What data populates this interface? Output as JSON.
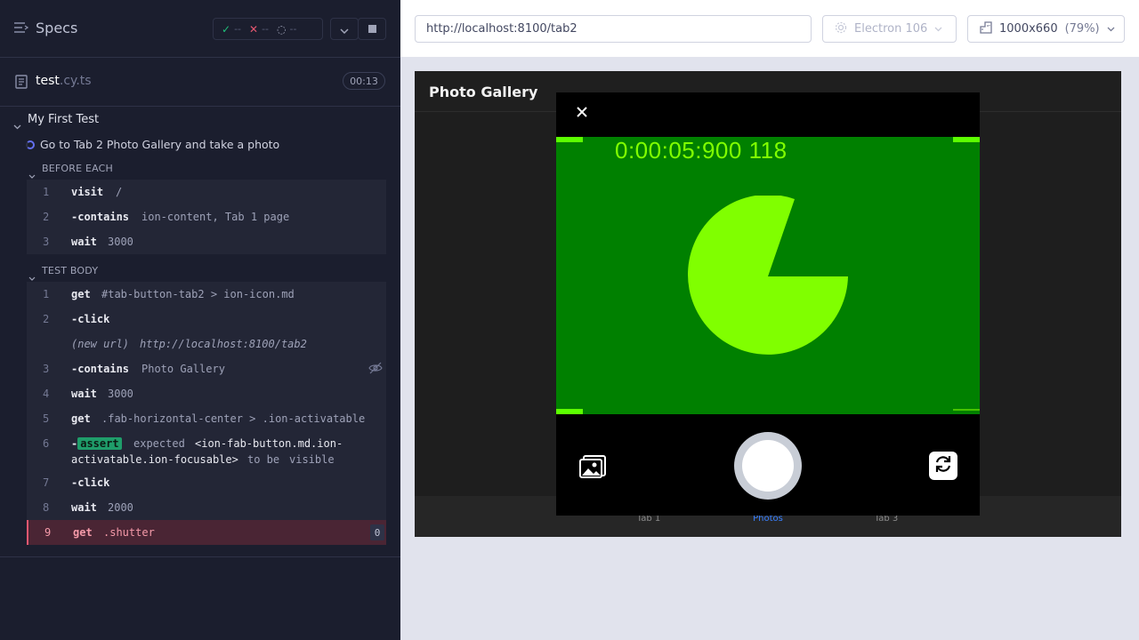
{
  "reporter": {
    "specs_label": "Specs",
    "stats": {
      "passed": "--",
      "failed": "--",
      "pending": "--"
    },
    "spec_file": {
      "name": "test",
      "ext": ".cy.ts",
      "duration": "00:13"
    },
    "suite_title": "My First Test",
    "test_title": "Go to Tab 2 Photo Gallery and take a photo",
    "before_each_label": "BEFORE EACH",
    "test_body_label": "TEST BODY",
    "before_each": [
      {
        "num": "1",
        "name": "visit",
        "message": "/"
      },
      {
        "num": "2",
        "name": "-contains",
        "message": "ion-content, Tab 1 page"
      },
      {
        "num": "3",
        "name": "wait",
        "message": "3000"
      }
    ],
    "test_body": [
      {
        "num": "1",
        "name": "get",
        "message": "#tab-button-tab2 > ion-icon.md"
      },
      {
        "num": "2",
        "name": "-click",
        "message": ""
      },
      {
        "num": "",
        "name": "(new url)",
        "message": "http://localhost:8100/tab2"
      },
      {
        "num": "3",
        "name": "-contains",
        "message": "Photo Gallery"
      },
      {
        "num": "4",
        "name": "wait",
        "message": "3000"
      },
      {
        "num": "5",
        "name": "get",
        "message": ".fab-horizontal-center > .ion-activatable"
      },
      {
        "num": "6",
        "name": "-",
        "assert_label": "assert",
        "expected": "expected",
        "subject_line1": "<ion-fab-button.md.ion-",
        "subject_line2": "activatable.ion-focusable>",
        "to_be": "to be",
        "visible": "visible"
      },
      {
        "num": "7",
        "name": "-click",
        "message": ""
      },
      {
        "num": "8",
        "name": "wait",
        "message": "2000"
      },
      {
        "num": "9",
        "name": "get",
        "message": ".shutter",
        "count": "0"
      }
    ]
  },
  "toolbar": {
    "url": "http://localhost:8100/tab2",
    "browser": "Electron 106",
    "viewport": "1000x660",
    "scale": "(79%)"
  },
  "app": {
    "title": "Photo Gallery",
    "camera_timestamp": "0:00:05:900 118",
    "tabs": [
      {
        "label": "Tab 1"
      },
      {
        "label": "Photos"
      },
      {
        "label": "Tab 3"
      }
    ]
  },
  "colors": {
    "accent": "#3880ff",
    "feed_bg": "#008000",
    "feed_fg": "#80ff00",
    "failed": "#e45770",
    "passed": "#1f9d6a"
  }
}
